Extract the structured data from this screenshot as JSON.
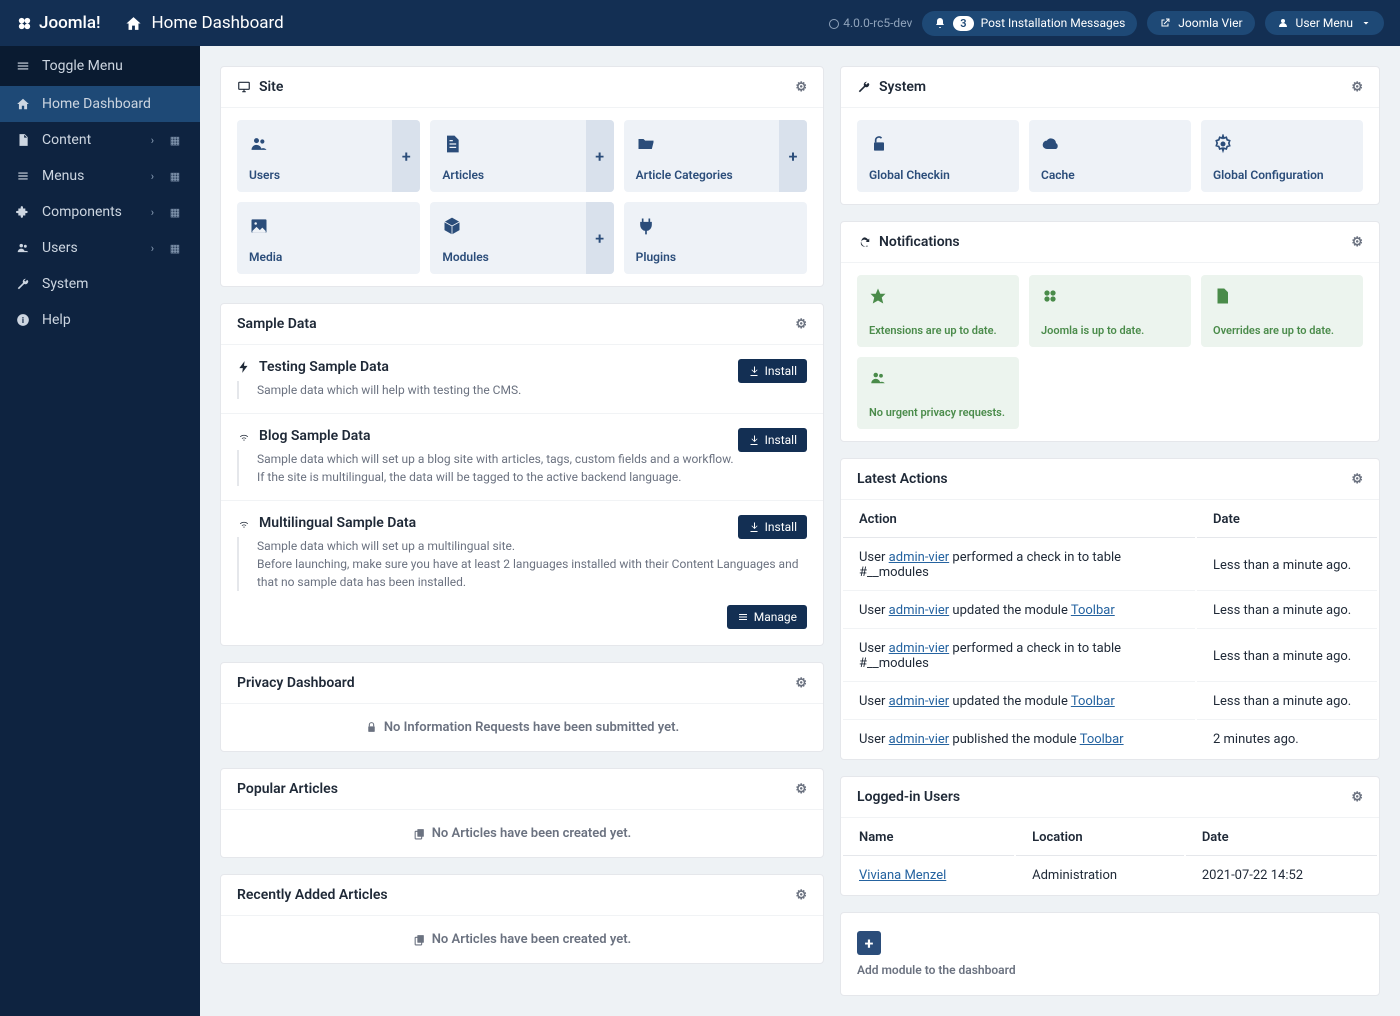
{
  "brand": "Joomla!",
  "pageTitle": "Home Dashboard",
  "version": "4.0.0-rc5-dev",
  "topbar": {
    "post_install_count": "3",
    "post_install_label": "Post Installation Messages",
    "site_name": "Joomla Vier",
    "user_menu": "User Menu"
  },
  "sidebar": {
    "toggle": "Toggle Menu",
    "home": "Home Dashboard",
    "content": "Content",
    "menus": "Menus",
    "components": "Components",
    "users": "Users",
    "system": "System",
    "help": "Help"
  },
  "site_panel": {
    "title": "Site",
    "users": "Users",
    "articles": "Articles",
    "categories": "Article Categories",
    "media": "Media",
    "modules": "Modules",
    "plugins": "Plugins"
  },
  "system_panel": {
    "title": "System",
    "checkin": "Global Checkin",
    "cache": "Cache",
    "config": "Global Configuration"
  },
  "sample_data": {
    "title": "Sample Data",
    "install": "Install",
    "manage": "Manage",
    "items": [
      {
        "title": "Testing Sample Data",
        "desc": "Sample data which will help with testing the CMS."
      },
      {
        "title": "Blog Sample Data",
        "desc": "Sample data which will set up a blog site with articles, tags, custom fields and a workflow.\nIf the site is multilingual, the data will be tagged to the active backend language."
      },
      {
        "title": "Multilingual Sample Data",
        "desc": "Sample data which will set up a multilingual site.\nBefore launching, make sure you have at least 2 languages installed with their Content Languages and that no sample data has been installed."
      }
    ]
  },
  "privacy": {
    "title": "Privacy Dashboard",
    "empty": "No Information Requests have been submitted yet."
  },
  "popular": {
    "title": "Popular Articles",
    "empty": "No Articles have been created yet."
  },
  "recent": {
    "title": "Recently Added Articles",
    "empty": "No Articles have been created yet."
  },
  "notifications": {
    "title": "Notifications",
    "ext": "Extensions are up to date.",
    "joomla": "Joomla is up to date.",
    "overrides": "Overrides are up to date.",
    "privacy": "No urgent privacy requests."
  },
  "actions": {
    "title": "Latest Actions",
    "col_action": "Action",
    "col_date": "Date",
    "rows": [
      {
        "pre": "User ",
        "user": "admin-vier",
        "post1": " performed a check in to table #__modules",
        "link": "",
        "post2": "",
        "date": "Less than a minute ago."
      },
      {
        "pre": "User ",
        "user": "admin-vier",
        "post1": " updated the module ",
        "link": "Toolbar",
        "post2": "",
        "date": "Less than a minute ago."
      },
      {
        "pre": "User ",
        "user": "admin-vier",
        "post1": " performed a check in to table #__modules",
        "link": "",
        "post2": "",
        "date": "Less than a minute ago."
      },
      {
        "pre": "User ",
        "user": "admin-vier",
        "post1": " updated the module ",
        "link": "Toolbar",
        "post2": "",
        "date": "Less than a minute ago."
      },
      {
        "pre": "User ",
        "user": "admin-vier",
        "post1": " published the module ",
        "link": "Toolbar",
        "post2": "",
        "date": "2 minutes ago."
      }
    ]
  },
  "logged_in": {
    "title": "Logged-in Users",
    "col_name": "Name",
    "col_location": "Location",
    "col_date": "Date",
    "user": {
      "name": "Viviana Menzel",
      "location": "Administration",
      "date": "2021-07-22 14:52"
    }
  },
  "add_module": "Add module to the dashboard"
}
